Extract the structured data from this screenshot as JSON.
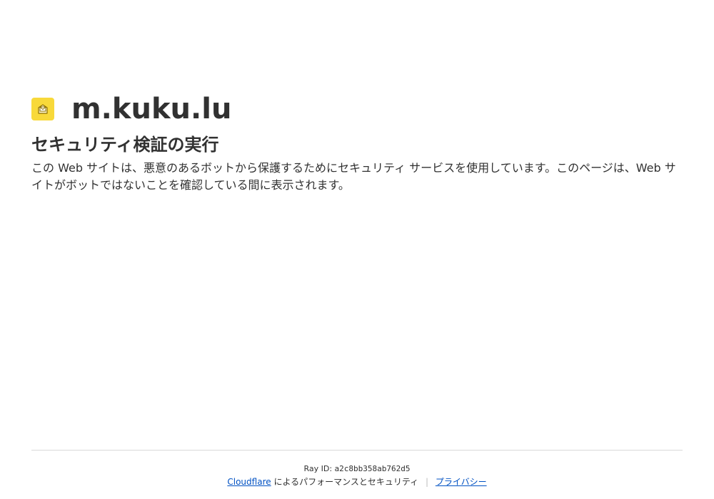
{
  "site": {
    "title": "m.kuku.lu",
    "favicon_icon": "mail-icon",
    "favicon_color": "#f8d93a"
  },
  "main": {
    "heading": "セキュリティ検証の実行",
    "description": "この Web サイトは、悪意のあるボットから保護するためにセキュリティ サービスを使用しています。このページは、Web サイトがボットではないことを確認している間に表示されます。"
  },
  "footer": {
    "ray_label": "Ray ID:",
    "ray_value": "a2c8bb358ab762d5",
    "cloudflare_link": "Cloudflare",
    "powered_text": "によるパフォーマンスとセキュリティ",
    "separator": "|",
    "privacy_link": "プライバシー",
    "link_color": "#0051c3"
  }
}
